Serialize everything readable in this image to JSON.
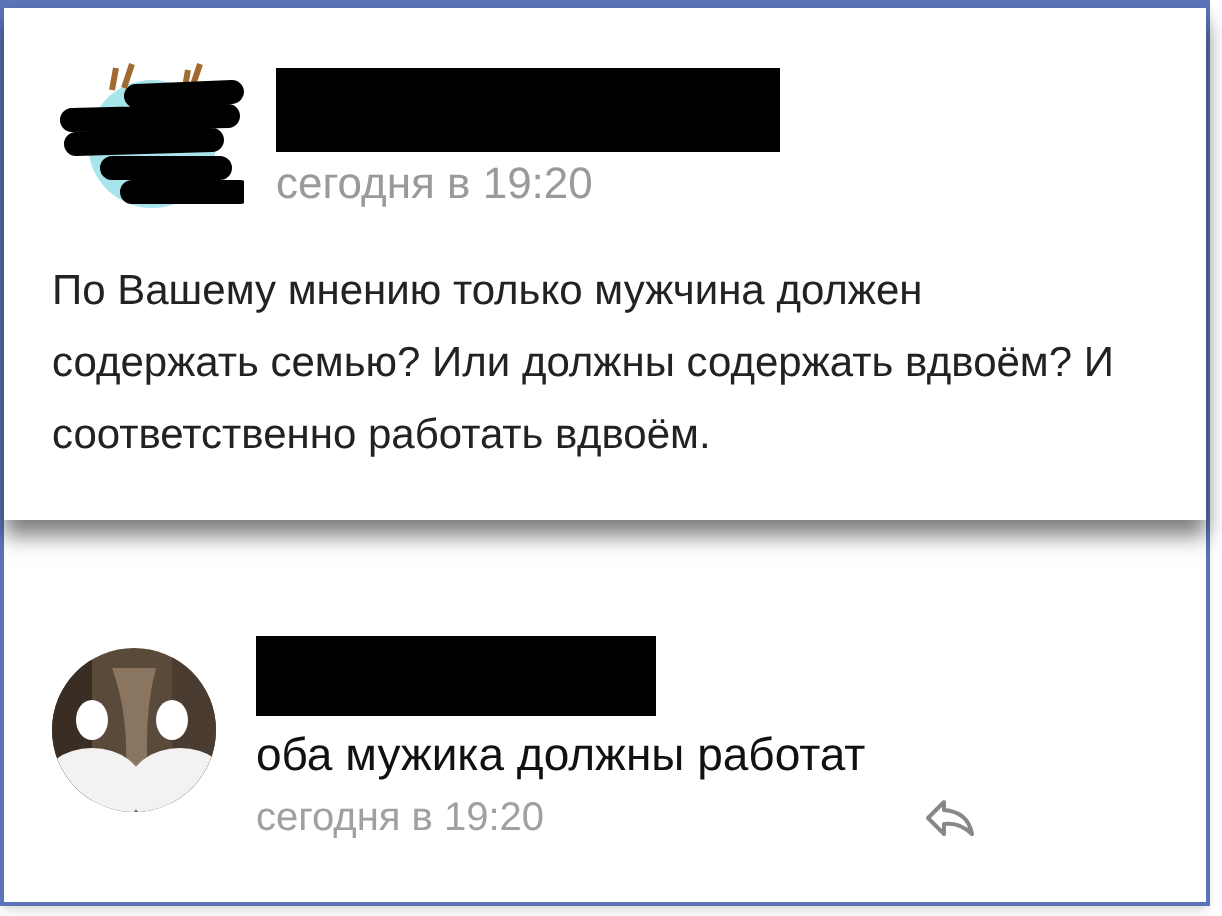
{
  "posts": [
    {
      "time": "сегодня в 19:20",
      "text": "По Вашему мнению только мужчина должен содержать семью? Или должны содержать вдвоём? И соответственно работать вдвоём."
    },
    {
      "time": "сегодня в 19:20",
      "text": "оба мужика должны работат"
    }
  ]
}
